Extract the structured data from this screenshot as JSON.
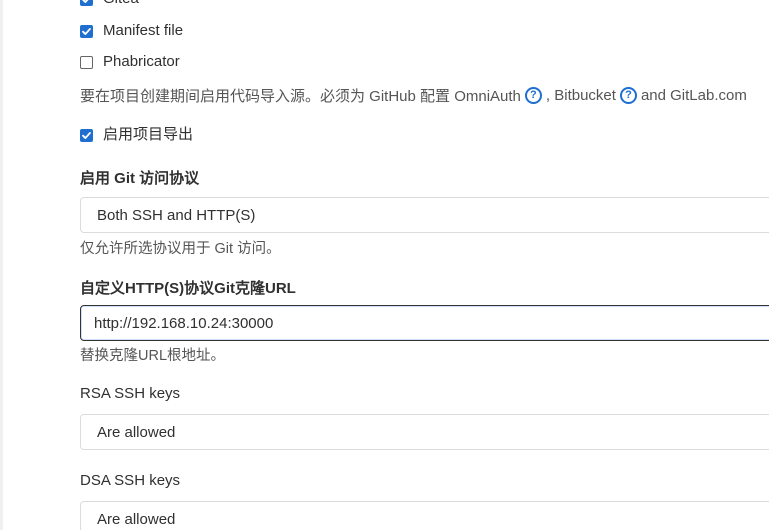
{
  "checkboxes": [
    {
      "label": "Gitea",
      "checked": true
    },
    {
      "label": "Manifest file",
      "checked": true
    },
    {
      "label": "Phabricator",
      "checked": false
    }
  ],
  "import_help": {
    "prefix": "要在项目创建期间启用代码导入源。必须为 GitHub 配置 OmniAuth",
    "sep1": ", Bitbucket",
    "sep2": "and GitLab.com"
  },
  "project_export": {
    "label": "启用项目导出",
    "checked": true
  },
  "git_protocol": {
    "label": "启用 Git 访问协议",
    "selected": "Both SSH and HTTP(S)",
    "hint": "仅允许所选协议用于 Git 访问。"
  },
  "clone_url": {
    "label": "自定义HTTP(S)协议Git克隆URL",
    "value": "http://192.168.10.24:30000",
    "hint": "替换克隆URL根地址。"
  },
  "rsa_keys": {
    "label": "RSA SSH keys",
    "selected": "Are allowed"
  },
  "dsa_keys": {
    "label": "DSA SSH keys",
    "selected": "Are allowed"
  }
}
